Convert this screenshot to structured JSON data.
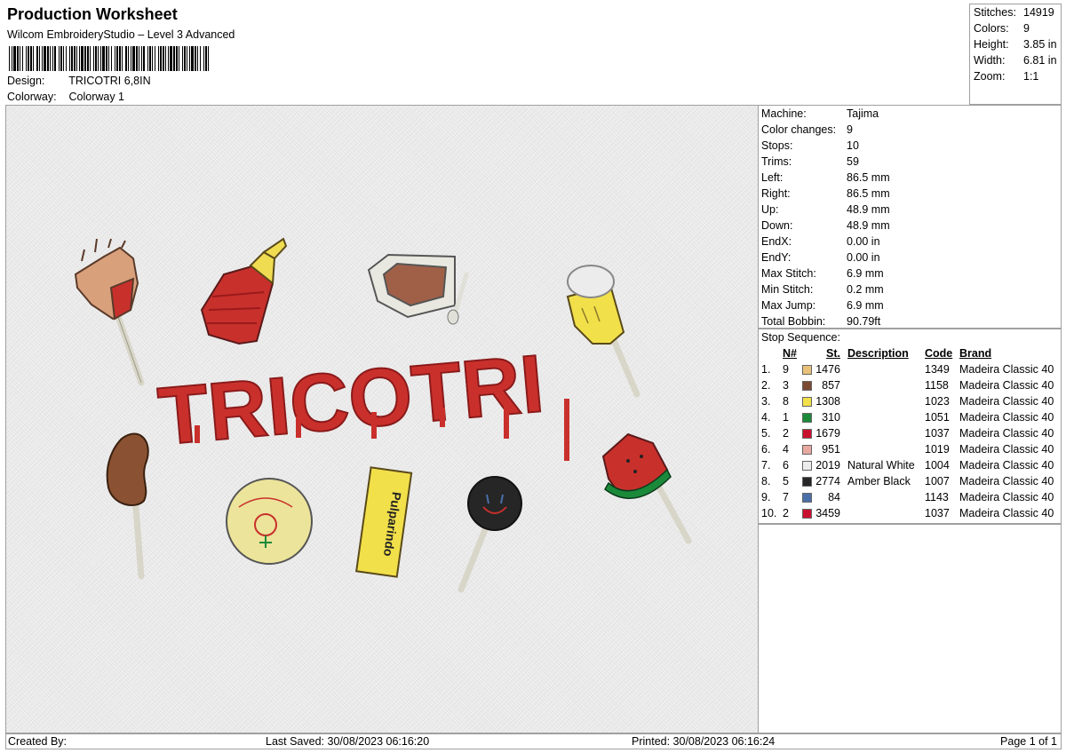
{
  "header": {
    "title": "Production Worksheet",
    "subtitle": "Wilcom EmbroideryStudio – Level 3 Advanced",
    "design_label": "Design:",
    "design_value": "TRICOTRI 6,8IN",
    "colorway_label": "Colorway:",
    "colorway_value": "Colorway 1"
  },
  "stats": [
    {
      "label": "Stitches:",
      "value": "14919"
    },
    {
      "label": "Colors:",
      "value": "9"
    },
    {
      "label": "Height:",
      "value": "3.85 in"
    },
    {
      "label": "Width:",
      "value": "6.81 in"
    },
    {
      "label": "Zoom:",
      "value": "1:1"
    }
  ],
  "machine_info": [
    {
      "label": "Machine:",
      "value": "Tajima"
    },
    {
      "label": "Color changes:",
      "value": "9"
    },
    {
      "label": "Stops:",
      "value": "10"
    },
    {
      "label": "Trims:",
      "value": "59"
    },
    {
      "label": "Left:",
      "value": "86.5 mm"
    },
    {
      "label": "Right:",
      "value": "86.5 mm"
    },
    {
      "label": "Up:",
      "value": "48.9 mm"
    },
    {
      "label": "Down:",
      "value": "48.9 mm"
    },
    {
      "label": "EndX:",
      "value": "0.00 in"
    },
    {
      "label": "EndY:",
      "value": "0.00 in"
    },
    {
      "label": "Max Stitch:",
      "value": "6.9 mm"
    },
    {
      "label": "Min Stitch:",
      "value": "0.2 mm"
    },
    {
      "label": "Max Jump:",
      "value": "6.9 mm"
    },
    {
      "label": "Total Bobbin:",
      "value": "90.79ft"
    }
  ],
  "stop_sequence": {
    "title": "Stop Sequence:",
    "headers": {
      "n": "N#",
      "st": "St.",
      "description": "Description",
      "code": "Code",
      "brand": "Brand"
    },
    "rows": [
      {
        "idx": "1.",
        "n": "9",
        "color": "#e8c27a",
        "st": "1476",
        "description": "",
        "code": "1349",
        "brand": "Madeira Classic 40"
      },
      {
        "idx": "2.",
        "n": "3",
        "color": "#7a4a32",
        "st": "857",
        "description": "",
        "code": "1158",
        "brand": "Madeira Classic 40"
      },
      {
        "idx": "3.",
        "n": "8",
        "color": "#f2e04a",
        "st": "1308",
        "description": "",
        "code": "1023",
        "brand": "Madeira Classic 40"
      },
      {
        "idx": "4.",
        "n": "1",
        "color": "#1a8a3a",
        "st": "310",
        "description": "",
        "code": "1051",
        "brand": "Madeira Classic 40"
      },
      {
        "idx": "5.",
        "n": "2",
        "color": "#c8102e",
        "st": "1679",
        "description": "",
        "code": "1037",
        "brand": "Madeira Classic 40"
      },
      {
        "idx": "6.",
        "n": "4",
        "color": "#e8a8a0",
        "st": "951",
        "description": "",
        "code": "1019",
        "brand": "Madeira Classic 40"
      },
      {
        "idx": "7.",
        "n": "6",
        "color": "#ececec",
        "st": "2019",
        "description": "Natural White",
        "code": "1004",
        "brand": "Madeira Classic 40"
      },
      {
        "idx": "8.",
        "n": "5",
        "color": "#262626",
        "st": "2774",
        "description": "Amber Black",
        "code": "1007",
        "brand": "Madeira Classic 40"
      },
      {
        "idx": "9.",
        "n": "7",
        "color": "#4a6fa8",
        "st": "84",
        "description": "",
        "code": "1143",
        "brand": "Madeira Classic 40"
      },
      {
        "idx": "10.",
        "n": "2",
        "color": "#c8102e",
        "st": "3459",
        "description": "",
        "code": "1037",
        "brand": "Madeira Classic 40"
      }
    ]
  },
  "design_preview": {
    "text": "TRICOTRI",
    "text_color": "#c9302c",
    "wrapper_text": "Pulparindo"
  },
  "footer": {
    "created_by": "Created By:",
    "last_saved": "Last Saved: 30/08/2023 06:16:20",
    "printed": "Printed: 30/08/2023 06:16:24",
    "page": "Page 1 of 1"
  }
}
